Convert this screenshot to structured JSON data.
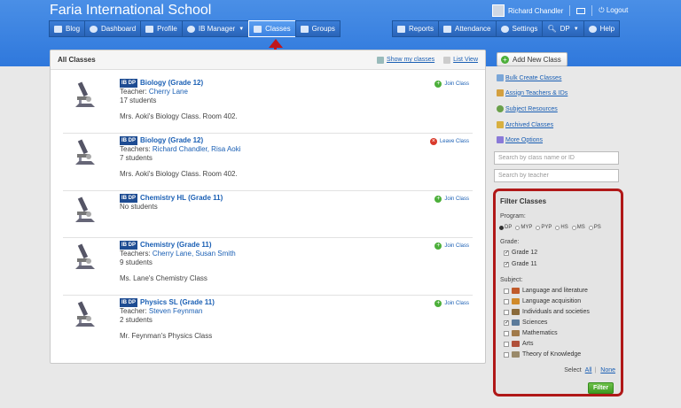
{
  "header": {
    "title": "Faria International School",
    "user_name": "Richard Chandler",
    "logout_label": "Logout",
    "nav_left": [
      {
        "label": "Blog",
        "icon": "blog-icon"
      },
      {
        "label": "Dashboard",
        "icon": "dashboard-icon"
      },
      {
        "label": "Profile",
        "icon": "profile-icon"
      },
      {
        "label": "IB Manager",
        "icon": "globe-icon"
      },
      {
        "label": "Classes",
        "icon": "classes-icon"
      },
      {
        "label": "Groups",
        "icon": "groups-icon"
      }
    ],
    "nav_right": [
      {
        "label": "Reports",
        "icon": "reports-icon"
      },
      {
        "label": "Attendance",
        "icon": "attendance-icon"
      },
      {
        "label": "Settings",
        "icon": "gear-icon"
      },
      {
        "label": "DP",
        "icon": "search-icon"
      },
      {
        "label": "Help",
        "icon": "help-icon"
      }
    ]
  },
  "main": {
    "title": "All Classes",
    "show_my_classes": "Show my classes",
    "list_view": "List View",
    "badge": "IB DP",
    "classes": [
      {
        "name": "Biology (Grade 12)",
        "teacher_prefix": "Teacher:",
        "teachers": "Cherry Lane",
        "students": "17 students",
        "description": "Mrs. Aoki's Biology Class. Room 402.",
        "action": "Join Class"
      },
      {
        "name": "Biology (Grade 12)",
        "teacher_prefix": "Teachers:",
        "teachers": "Richard Chandler, Risa Aoki",
        "students": "7 students",
        "description": "Mrs. Aoki's Biology Class. Room 402.",
        "action": "Leave Class"
      },
      {
        "name": "Chemistry HL (Grade 11)",
        "teacher_prefix": "",
        "teachers": "",
        "students": "No students",
        "description": "",
        "action": "Join Class"
      },
      {
        "name": "Chemistry (Grade 11)",
        "teacher_prefix": "Teachers:",
        "teachers": "Cherry Lane, Susan Smith",
        "students": "9 students",
        "description": "Ms. Lane's Chemistry Class",
        "action": "Join Class"
      },
      {
        "name": "Physics SL (Grade 11)",
        "teacher_prefix": "Teacher:",
        "teachers": "Steven Feynman",
        "students": "2 students",
        "description": "Mr. Feynman's Physics Class",
        "action": "Join Class"
      }
    ]
  },
  "sidebar": {
    "add_button": "Add New Class",
    "links": [
      "Bulk Create Classes",
      "Assign Teachers & IDs",
      "Subject Resources",
      "Archived Classes",
      "More Options"
    ],
    "search_class_placeholder": "Search by class name or ID",
    "search_teacher_placeholder": "Search by teacher",
    "filter": {
      "title": "Filter Classes",
      "program_label": "Program:",
      "programs": [
        {
          "label": "DP",
          "selected": true
        },
        {
          "label": "MYP",
          "selected": false
        },
        {
          "label": "PYP",
          "selected": false
        },
        {
          "label": "HS",
          "selected": false
        },
        {
          "label": "MS",
          "selected": false
        },
        {
          "label": "PS",
          "selected": false
        }
      ],
      "grade_label": "Grade:",
      "grades": [
        {
          "label": "Grade 12",
          "checked": true
        },
        {
          "label": "Grade 11",
          "checked": true
        }
      ],
      "subject_label": "Subject:",
      "subjects": [
        {
          "label": "Language and literature",
          "checked": false,
          "color": "#c05a2a"
        },
        {
          "label": "Language acquisition",
          "checked": false,
          "color": "#d08a2a"
        },
        {
          "label": "Individuals and societies",
          "checked": false,
          "color": "#8a6a3a"
        },
        {
          "label": "Sciences",
          "checked": true,
          "color": "#5a7a9a"
        },
        {
          "label": "Mathematics",
          "checked": false,
          "color": "#a07a4a"
        },
        {
          "label": "Arts",
          "checked": false,
          "color": "#b0503a"
        },
        {
          "label": "Theory of Knowledge",
          "checked": false,
          "color": "#9a8a6a"
        }
      ],
      "select_prefix": "Select",
      "select_all": "All",
      "select_none": "None",
      "filter_button": "Filter"
    }
  }
}
